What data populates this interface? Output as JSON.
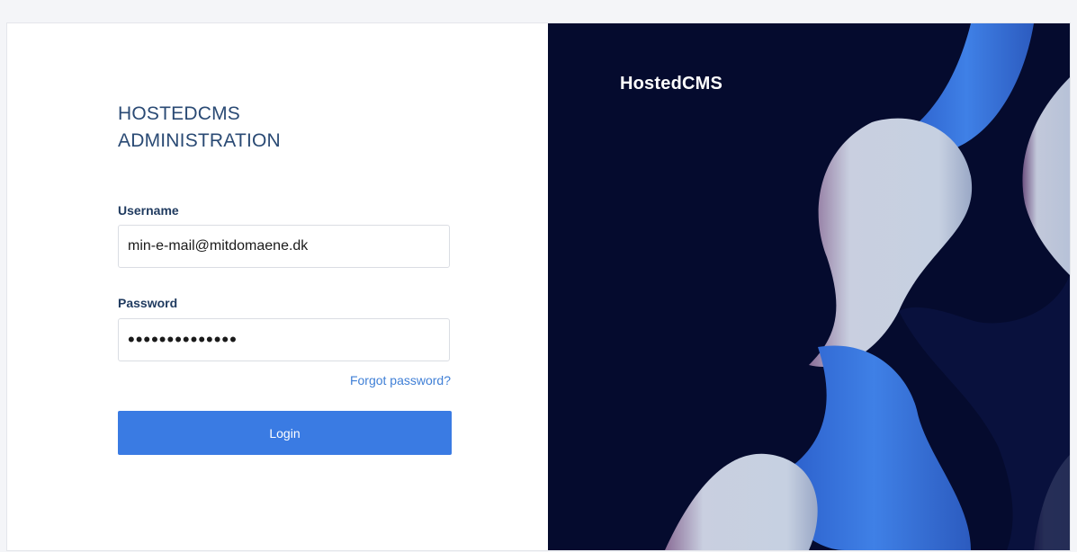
{
  "login_panel": {
    "title_line1": "HOSTEDCMS",
    "title_line2": "ADMINISTRATION",
    "username_label": "Username",
    "username_value": "min-e-mail@mitdomaene.dk",
    "password_label": "Password",
    "password_value": "••••••••••••••",
    "forgot_password_label": "Forgot password?",
    "login_button_label": "Login"
  },
  "brand_panel": {
    "brand_name": "HostedCMS",
    "colors": {
      "background": "#050b2e",
      "wave_light": "#c3cde0",
      "wave_blue": "#3a78e0",
      "wave_pink": "#7e5f8c"
    }
  },
  "colors": {
    "accent": "#3a7be3",
    "heading": "#2a4a74",
    "link": "#3f7fd6"
  }
}
